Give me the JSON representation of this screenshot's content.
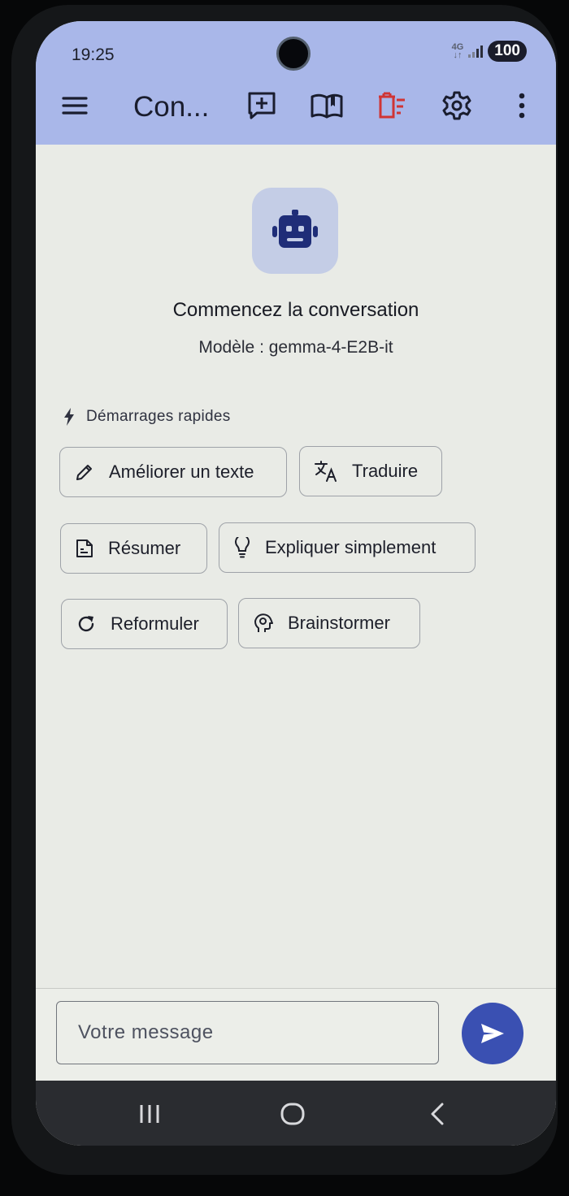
{
  "status_bar": {
    "time": "19:25",
    "network": "4G",
    "battery": "100"
  },
  "app_bar": {
    "title": "Con...",
    "icons": [
      "menu-icon",
      "new-chat-icon",
      "library-icon",
      "clear-chat-icon",
      "settings-icon",
      "more-options-icon"
    ],
    "delete_color": "#d03434"
  },
  "main": {
    "heading": "Commencez la conversation",
    "model_label": "Modèle : gemma-4-E2B-it",
    "quick_starts_label": "Démarrages rapides",
    "chips": [
      {
        "label": "Améliorer un texte",
        "icon": "pencil-icon"
      },
      {
        "label": "Traduire",
        "icon": "translate-icon"
      },
      {
        "label": "Résumer",
        "icon": "summary-icon"
      },
      {
        "label": "Expliquer simplement",
        "icon": "lightbulb-icon"
      },
      {
        "label": "Reformuler",
        "icon": "refresh-icon"
      },
      {
        "label": "Brainstormer",
        "icon": "psychology-icon"
      }
    ]
  },
  "composer": {
    "placeholder": "Votre message"
  },
  "colors": {
    "accent": "#3a50b2",
    "app_bar": "#a9b7e9",
    "background": "#e9ebe6"
  }
}
